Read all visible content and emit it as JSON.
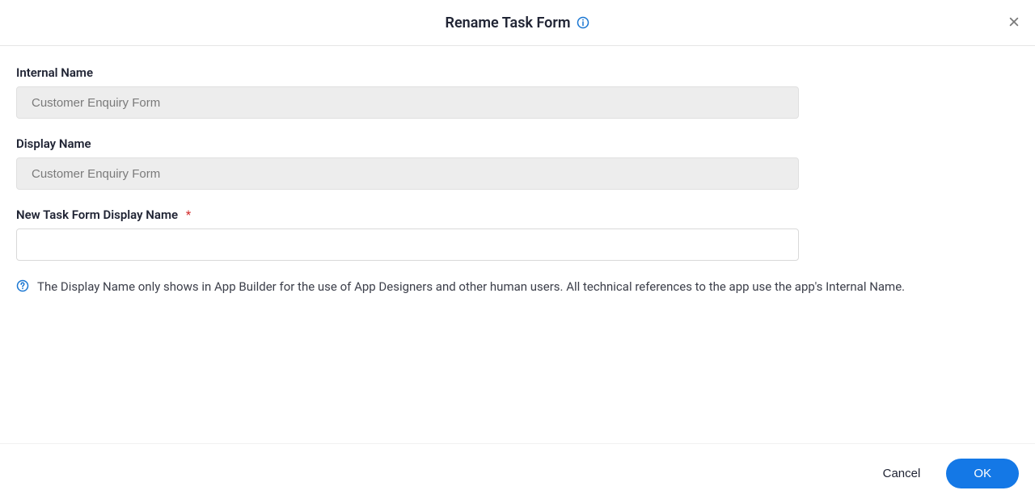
{
  "header": {
    "title": "Rename Task Form"
  },
  "form": {
    "internal_name": {
      "label": "Internal Name",
      "value": "Customer Enquiry Form"
    },
    "display_name": {
      "label": "Display Name",
      "value": "Customer Enquiry Form"
    },
    "new_display_name": {
      "label": "New Task Form Display Name",
      "required_marker": "*",
      "value": ""
    },
    "help_text": "The Display Name only shows in App Builder for the use of App Designers and other human users. All technical references to the app use the app's Internal Name."
  },
  "footer": {
    "cancel_label": "Cancel",
    "ok_label": "OK"
  }
}
